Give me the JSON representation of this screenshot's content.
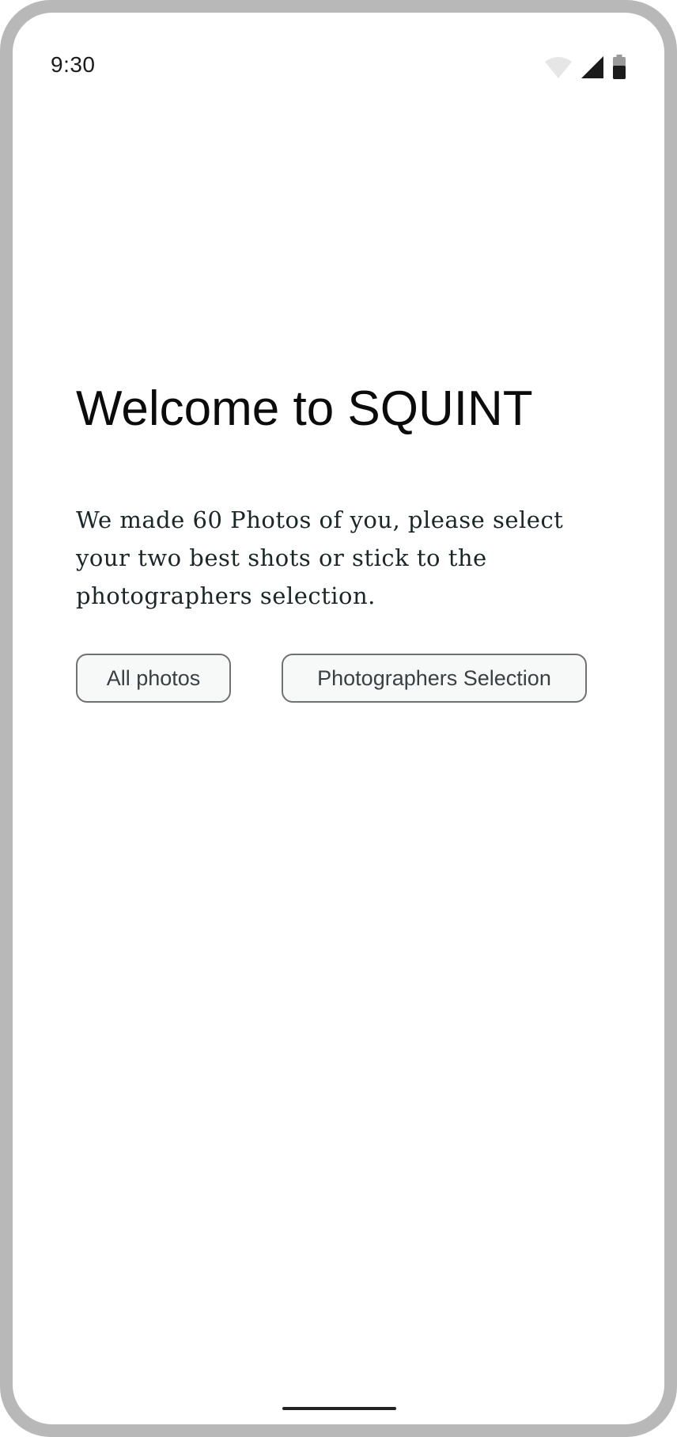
{
  "status_bar": {
    "time": "9:30",
    "icons": [
      "wifi-icon",
      "cellular-signal-icon",
      "battery-icon"
    ]
  },
  "main": {
    "title": "Welcome to SQUINT",
    "description": "We made 60 Photos of you, please select your two best shots or stick to the photographers selection.",
    "buttons": {
      "all_photos": "All photos",
      "photographers_selection": "Photographers Selection"
    }
  },
  "colors": {
    "frame": "#b8b8b8",
    "background": "#ffffff",
    "button_border": "#717171",
    "button_bg": "#f7f9f9",
    "body_text": "#1b2629"
  }
}
